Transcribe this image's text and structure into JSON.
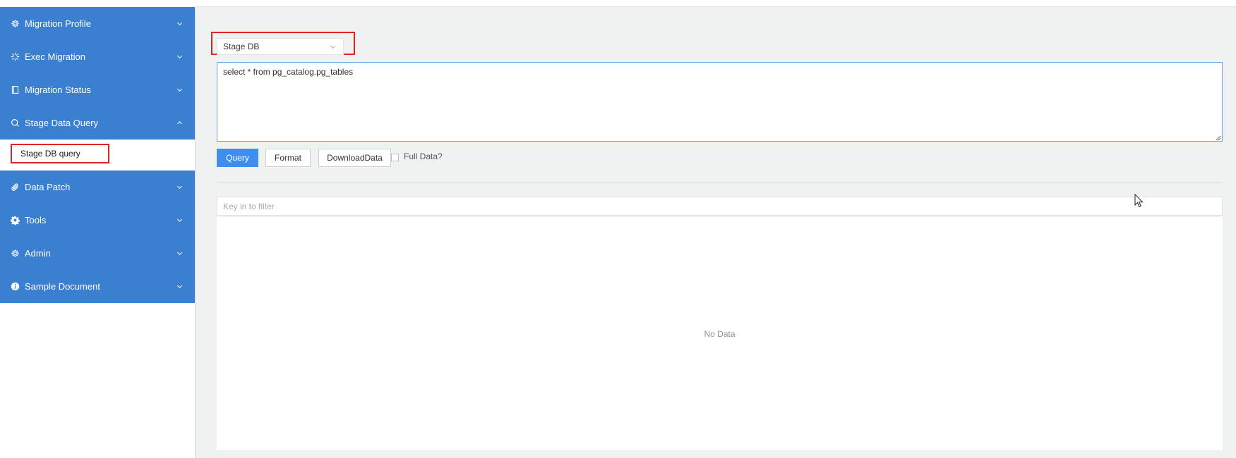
{
  "sidebar": {
    "items": [
      {
        "label": "Migration Profile",
        "icon": "gear-icon"
      },
      {
        "label": "Exec Migration",
        "icon": "loading-spinner-icon"
      },
      {
        "label": "Migration Status",
        "icon": "book-icon"
      },
      {
        "label": "Stage Data Query",
        "icon": "search-icon",
        "expanded": true
      },
      {
        "label": "Data Patch",
        "icon": "paperclip-icon"
      },
      {
        "label": "Tools",
        "icon": "cog-filled-icon"
      },
      {
        "label": "Admin",
        "icon": "gear-icon"
      },
      {
        "label": "Sample Document",
        "icon": "info-icon"
      }
    ],
    "submenu": {
      "selected_label": "Stage DB query"
    },
    "menu_color": "#3a7fd0"
  },
  "main": {
    "db_select": {
      "value": "Stage DB"
    },
    "sql_editor": {
      "value": "select * from pg_catalog.pg_tables"
    },
    "buttons": {
      "query": "Query",
      "format": "Format",
      "download": "DownloadData"
    },
    "full_data": {
      "label": "Full Data?",
      "checked": false
    },
    "filter": {
      "placeholder": "Key in to filter",
      "value": ""
    },
    "results": {
      "empty_text": "No Data"
    },
    "accent_color": "#3d8ef0",
    "highlight_color": "#e02424"
  }
}
